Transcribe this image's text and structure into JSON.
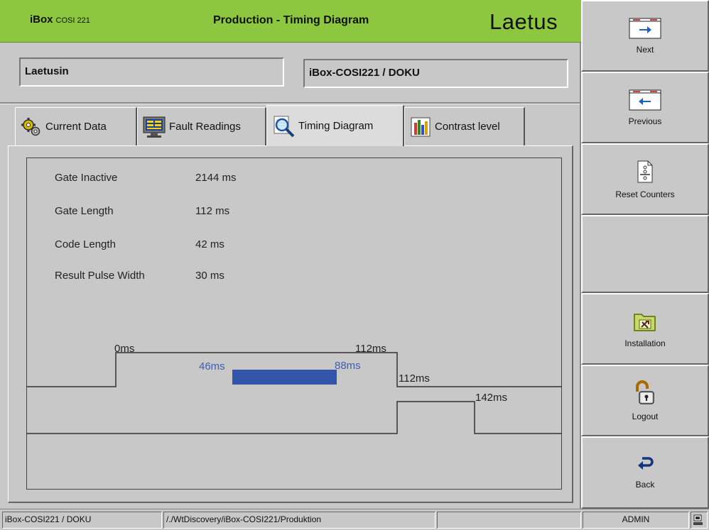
{
  "header": {
    "brand": "iBox",
    "model": "COSI 221",
    "title": "Production - Timing Diagram",
    "vendor_logo": "Laetus",
    "accent_color": "#8dc63f"
  },
  "info": {
    "line_name": "Laetusin",
    "device_name": "iBox-COSI221 / DOKU"
  },
  "tabs": [
    {
      "label": "Current Data",
      "icon": "gears-icon",
      "active": false
    },
    {
      "label": "Fault Readings",
      "icon": "monitor-icon",
      "active": false
    },
    {
      "label": "Timing Diagram",
      "icon": "magnifier-icon",
      "active": true
    },
    {
      "label": "Contrast level",
      "icon": "bar-chart-icon",
      "active": false
    }
  ],
  "stats": [
    {
      "label": "Gate Inactive",
      "value": "2144 ms"
    },
    {
      "label": "Gate Length",
      "value": "112 ms"
    },
    {
      "label": "Code Length",
      "value": "42 ms"
    },
    {
      "label": "Result Pulse Width",
      "value": "30 ms"
    }
  ],
  "diagram": {
    "gate_start_label": "0ms",
    "gate_end_label": "112ms",
    "code_start_label": "46ms",
    "code_end_label": "88ms",
    "result_start_label": "112ms",
    "result_end_label": "142ms",
    "code_color": "#3355aa"
  },
  "sidebar": {
    "next": "Next",
    "previous": "Previous",
    "reset": "Reset Counters",
    "installation": "Installation",
    "logout": "Logout",
    "back": "Back"
  },
  "status": {
    "device": "iBox-COSI221 / DOKU",
    "path": "/./WtDiscovery/iBox-COSI221/Produktion",
    "user": "ADMIN"
  }
}
